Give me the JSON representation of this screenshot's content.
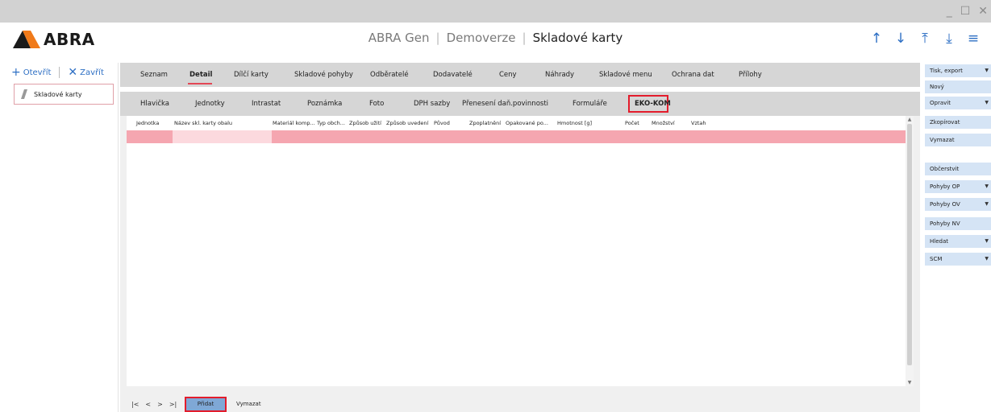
{
  "window": {
    "minimize": "_",
    "maximize": "☐",
    "close": "✕"
  },
  "header": {
    "logo_text": "ABRA",
    "app": "ABRA Gen",
    "context": "Demoverze",
    "title": "Skladové karty",
    "actions": [
      "↑",
      "↓",
      "⤒",
      "⤓",
      "≡"
    ]
  },
  "left_panel": {
    "open_label": "Otevřít",
    "close_label": "Zavřít",
    "items": [
      {
        "label": "Skladové karty"
      }
    ]
  },
  "tabs_primary": [
    {
      "label": "Seznam",
      "active": false
    },
    {
      "label": "Detail",
      "active": true
    },
    {
      "label": "Dílčí karty",
      "active": false
    },
    {
      "label": "Skladové pohyby",
      "active": false
    },
    {
      "label": "Odběratelé",
      "active": false
    },
    {
      "label": "Dodavatelé",
      "active": false
    },
    {
      "label": "Ceny",
      "active": false
    },
    {
      "label": "Náhrady",
      "active": false
    },
    {
      "label": "Skladové menu",
      "active": false
    },
    {
      "label": "Ochrana dat",
      "active": false
    },
    {
      "label": "Přílohy",
      "active": false
    }
  ],
  "tabs_secondary": [
    {
      "label": "Hlavička",
      "active": false
    },
    {
      "label": "Jednotky",
      "active": false
    },
    {
      "label": "Intrastat",
      "active": false
    },
    {
      "label": "Poznámka",
      "active": false
    },
    {
      "label": "Foto",
      "active": false
    },
    {
      "label": "DPH sazby",
      "active": false
    },
    {
      "label": "Přenesení daň.povinnosti",
      "active": false
    },
    {
      "label": "Formuláře",
      "active": false
    },
    {
      "label": "EKO-KOM",
      "active": true
    }
  ],
  "grid": {
    "columns": [
      "Jednotka",
      "Název skl. karty obalu",
      "Materiál komp...",
      "Typ obch...",
      "Způsob užití",
      "Způsob uvedení",
      "Původ",
      "Zpoplatnění",
      "Opakované po...",
      "Hmotnost [g]",
      "Počet",
      "Množství",
      "Vztah"
    ]
  },
  "pager": {
    "first": "|<",
    "prev": "<",
    "next": ">",
    "last": ">|"
  },
  "actions": {
    "add": "Přidat",
    "delete": "Vymazat"
  },
  "right_panel": [
    {
      "label": "Tisk, export",
      "dropdown": true
    },
    {
      "label": "Nový",
      "dropdown": false
    },
    {
      "label": "Opravit",
      "dropdown": true
    },
    {
      "label": "Zkopírovat",
      "dropdown": false
    },
    {
      "label": "Vymazat",
      "dropdown": false
    },
    {
      "label": "Občerstvit",
      "dropdown": false
    },
    {
      "label": "Pohyby OP",
      "dropdown": true
    },
    {
      "label": "Pohyby OV",
      "dropdown": true
    },
    {
      "label": "Pohyby NV",
      "dropdown": false
    },
    {
      "label": "Hledat",
      "dropdown": true
    },
    {
      "label": "SCM",
      "dropdown": true
    }
  ],
  "colors": {
    "accent": "#2d6fc4",
    "active_underline": "#e34755",
    "highlight_row": "#f5a6b0",
    "button_blue": "#d5e4f5",
    "logo_orange": "#f07a1a",
    "logo_dark": "#1b1b1b"
  }
}
